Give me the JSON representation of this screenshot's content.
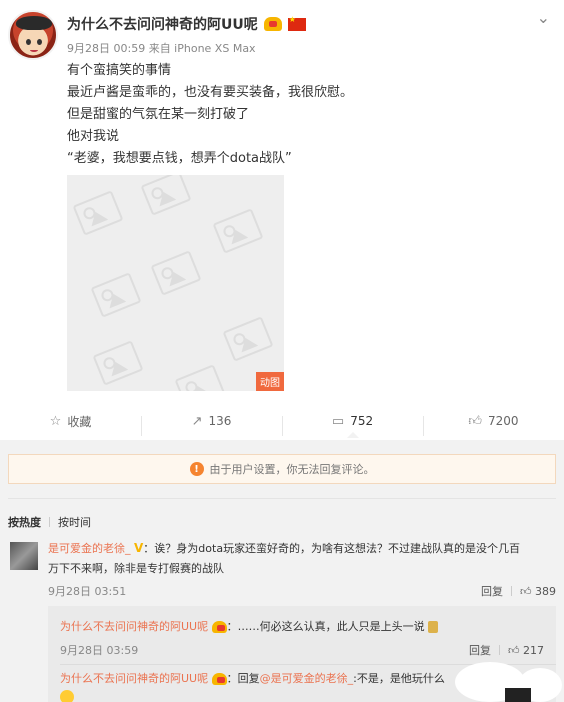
{
  "post": {
    "author": "为什么不去问问神奇的阿UU呢",
    "meta": "9月28日 00:59 来自 iPhone XS Max",
    "lines": [
      "有个蛮搞笑的事情",
      "最近卢酱是蛮乖的，也没有要买装备，我很欣慰。",
      "但是甜蜜的气氛在某一刻打破了",
      "他对我说",
      "“老婆，我想要点钱，想弄个dota战队”"
    ],
    "media_badge": "动图"
  },
  "actions": {
    "favorite": "收藏",
    "repost": "136",
    "comment": "752",
    "like": "7200"
  },
  "notice": "由于用户设置，你无法回复评论。",
  "sort": {
    "hot": "按热度",
    "time": "按时间"
  },
  "comment": {
    "nick": "是可爱金的老徐_",
    "text_line1": "：诶？身为dota玩家还蛮好奇的，为啥有这想法？不过建战队真的是没个几百",
    "text_line2": "万下不来啊，除非是专打假赛的战队",
    "time": "9月28日 03:51",
    "reply_label": "回复",
    "likes": "389"
  },
  "replies": [
    {
      "nick": "为什么不去问问神奇的阿UU呢",
      "text": "：……何必这么认真，此人只是上头一说",
      "time": "9月28日 03:59",
      "reply_label": "回复",
      "likes": "217"
    },
    {
      "nick": "为什么不去问问神奇的阿UU呢",
      "prefix": "：回复",
      "at": "@是可爱金的老徐_",
      "text": ":不是，是他玩什么"
    }
  ]
}
